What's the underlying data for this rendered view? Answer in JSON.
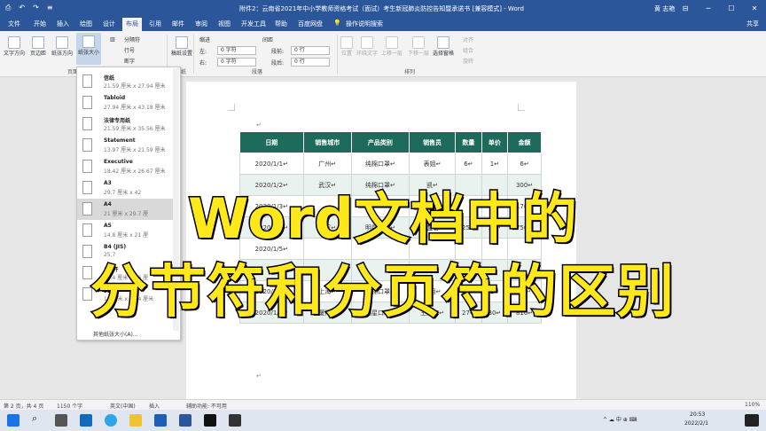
{
  "window": {
    "title": "附件2：云南省2021年中小学教师资格考试（面试）考生新冠肺炎防控告知暨承诺书 [兼容模式] - Word",
    "user": "黄 志艳",
    "quick_access": [
      "⎙",
      "↶",
      "↷",
      "≡"
    ],
    "controls": [
      "⊟",
      "─",
      "☐",
      "✕"
    ]
  },
  "tabs": [
    "文件",
    "开始",
    "插入",
    "绘图",
    "设计",
    "布局",
    "引用",
    "邮件",
    "审阅",
    "视图",
    "开发工具",
    "帮助",
    "百度网盘",
    "操作说明搜索"
  ],
  "tabs_active": "布局",
  "share": "共享",
  "ribbon": {
    "page_setup_buttons": [
      "文字方向",
      "页边距",
      "纸张方向",
      "纸张大小"
    ],
    "columns_menu": [
      "分隔符",
      "行号",
      "断字"
    ],
    "group_page_setup": "页面",
    "draft_button": "稿纸设置",
    "group_draft": "稿纸",
    "indent_label": "缩进",
    "indent_left_label": "左:",
    "indent_left": "0 字符",
    "indent_right_label": "右:",
    "indent_right": "0 字符",
    "spacing_label": "间距",
    "spacing_before_label": "段前:",
    "spacing_before": "0 行",
    "spacing_after_label": "段后:",
    "spacing_after": "0 行",
    "group_paragraph": "段落",
    "arrange_buttons": [
      "位置",
      "环绕文字",
      "上移一层",
      "下移一层",
      "选择窗格"
    ],
    "align_menu": [
      "对齐",
      "组合",
      "旋转"
    ],
    "group_arrange": "排列"
  },
  "paper_size_dropdown": {
    "items": [
      {
        "name": "信纸",
        "size": "21.59 厘米 x 27.94 厘米"
      },
      {
        "name": "Tabloid",
        "size": "27.94 厘米 x 43.18 厘米"
      },
      {
        "name": "法律专用纸",
        "size": "21.59 厘米 x 35.56 厘米"
      },
      {
        "name": "Statement",
        "size": "13.97 厘米 x 21.59 厘米"
      },
      {
        "name": "Executive",
        "size": "18.42 厘米 x 26.67 厘米"
      },
      {
        "name": "A3",
        "size": "29.7 厘米 x 42"
      },
      {
        "name": "A4",
        "size": "21 厘米 x 29.7 厘"
      },
      {
        "name": "A5",
        "size": "14.8 厘米 x 21 厘"
      },
      {
        "name": "B4 (JIS)",
        "size": "25.7"
      },
      {
        "name": "16 开",
        "size": "18.4 厘米 x 26 厘"
      },
      {
        "name": "32 开",
        "size": "13 厘米 x 18.4 厘米"
      }
    ],
    "selected_index": 6,
    "more": "其他纸张大小(A)..."
  },
  "table": {
    "headers": [
      "日期",
      "销售城市",
      "产品类别",
      "销售员",
      "数量",
      "单价",
      "金额"
    ],
    "rows": [
      [
        "2020/1/1↵",
        "广州↵",
        "纯棉口罩↵",
        "表姐↵",
        "6↵",
        "1↵",
        "6↵"
      ],
      [
        "2020/1/2↵",
        "武汉↵",
        "纯棉口罩↵",
        "凯↵",
        "",
        "",
        "300↵"
      ],
      [
        "2020/1/3↵",
        "",
        "",
        "",
        "",
        "",
        "176↵"
      ],
      [
        "2020/1/4↵",
        "武汉↵",
        "明星口罩↵",
        "张盛茗↵",
        "25↵",
        "30↵",
        "750↵"
      ],
      [
        "2020/1/5↵",
        "",
        "",
        "",
        "",
        "",
        ""
      ],
      [
        "",
        "",
        "",
        "",
        "",
        "",
        ""
      ],
      [
        "2020/1/5↵",
        "上海↵",
        "纯棉口罩↵",
        "表姐↵",
        "60↵",
        "1↵",
        "60↵"
      ],
      [
        "2020/1/6↵",
        "厦门↵",
        "明星口罩↵",
        "王大刀↵",
        "27↵",
        "30↵",
        "810↵"
      ]
    ],
    "para_mark": "↵"
  },
  "overlay": {
    "line1": "Word文档中的",
    "line2": "分节符和分页符的区别"
  },
  "status": {
    "page": "第 2 页，共 4 页",
    "words": "1150 个字",
    "lang": "英文(中国)",
    "mode": "插入",
    "accessibility": "辅助功能: 不可用",
    "zoom": "110%"
  },
  "taskbar": {
    "search": "⌕",
    "tray": "^ ☁ 中 ⊕ ⌨",
    "time": "20:53",
    "date": "2022/2/1"
  },
  "colors": {
    "word_blue": "#2b579a",
    "table_header": "#1e6b5c",
    "overlay_text": "#ffe81a"
  }
}
